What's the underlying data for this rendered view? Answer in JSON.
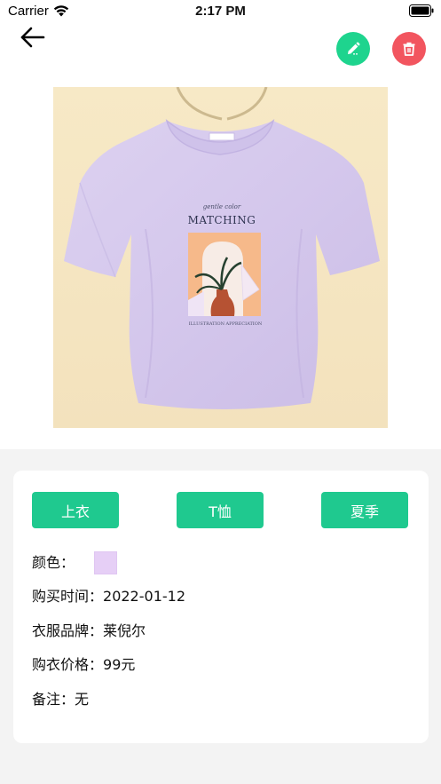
{
  "status_bar": {
    "carrier": "Carrier",
    "time": "2:17 PM"
  },
  "header": {
    "back_icon": "arrow-left-icon",
    "edit_icon": "pencil-icon",
    "delete_icon": "trash-icon",
    "edit_color": "#1ed48e",
    "delete_color": "#f2555f"
  },
  "product": {
    "print_script": "gentle color",
    "print_title": "MATCHING",
    "print_caption": "ILLUSTRATION APPRECIATION"
  },
  "tags": [
    {
      "label": "上衣"
    },
    {
      "label": "T恤"
    },
    {
      "label": "夏季"
    }
  ],
  "details": {
    "color_label": "颜色：",
    "color_value": "#e6cff6",
    "purchase_date_label": "购买时间：",
    "purchase_date": "2022-01-12",
    "brand_label": "衣服品牌：",
    "brand": "莱倪尔",
    "price_label": "购衣价格：",
    "price": "99元",
    "note_label": "备注：",
    "note": "无"
  },
  "theme": {
    "accent": "#1fc98f",
    "background": "#f3f3f3"
  }
}
